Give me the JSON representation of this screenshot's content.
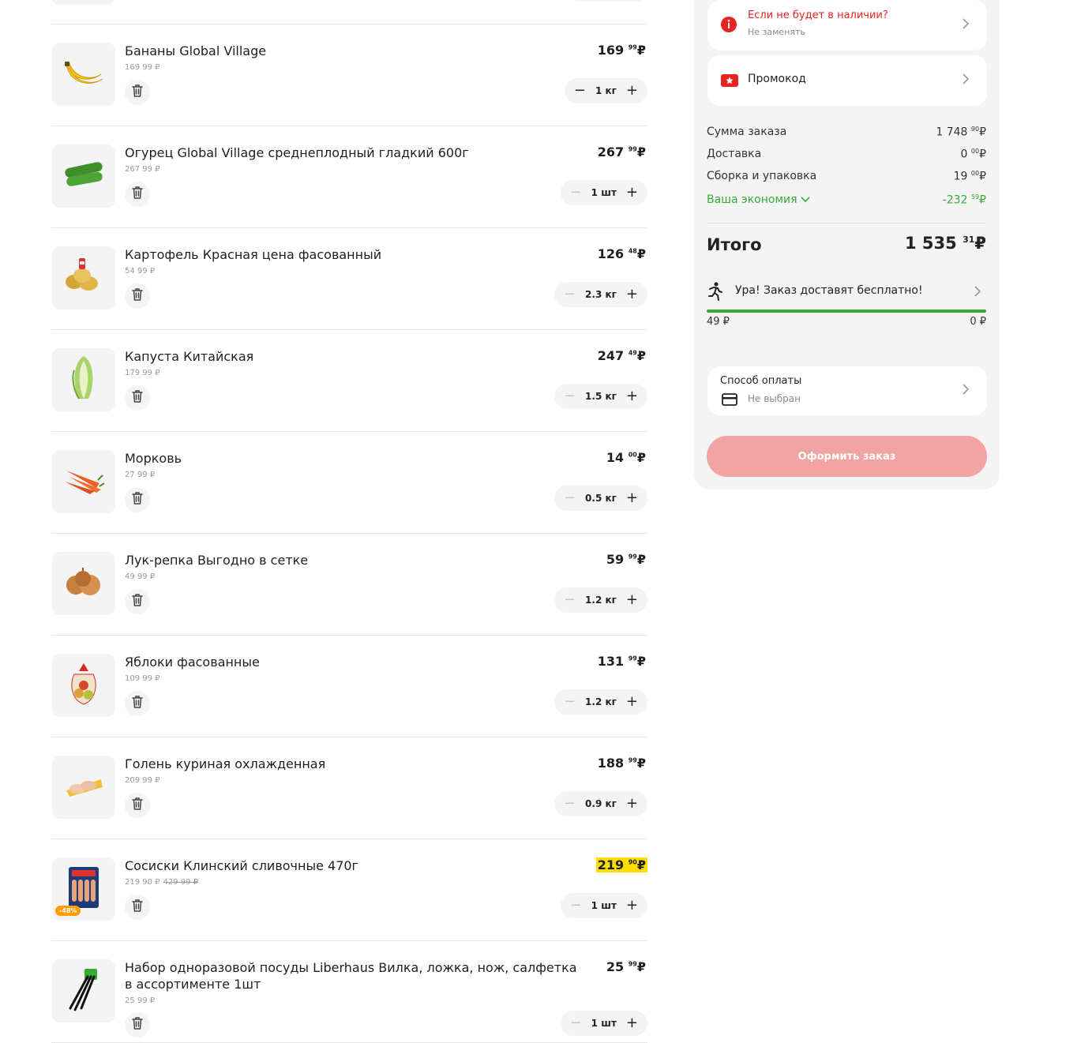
{
  "cart": {
    "items": [
      {
        "title": "Бананы Global Village",
        "unit_price": "169 99 ₽",
        "old_price": "",
        "total_main": "169",
        "total_kop": "99",
        "currency": "₽",
        "qty": "1 кг",
        "promo": false,
        "discount": "",
        "icon": "banana"
      },
      {
        "title": "Огурец Global Village среднеплодный гладкий 600г",
        "unit_price": "267 99 ₽",
        "old_price": "",
        "total_main": "267",
        "total_kop": "99",
        "currency": "₽",
        "qty": "1 шт",
        "promo": false,
        "discount": "",
        "icon": "cucumber"
      },
      {
        "title": "Картофель Красная цена фасованный",
        "unit_price": "54 99 ₽",
        "old_price": "",
        "total_main": "126",
        "total_kop": "48",
        "currency": "₽",
        "qty": "2.3 кг",
        "promo": false,
        "discount": "",
        "icon": "potato"
      },
      {
        "title": "Капуста Китайская",
        "unit_price": "179 99 ₽",
        "old_price": "",
        "total_main": "247",
        "total_kop": "49",
        "currency": "₽",
        "qty": "1.5 кг",
        "promo": false,
        "discount": "",
        "icon": "cabbage"
      },
      {
        "title": "Морковь",
        "unit_price": "27 99 ₽",
        "old_price": "",
        "total_main": "14",
        "total_kop": "00",
        "currency": "₽",
        "qty": "0.5 кг",
        "promo": false,
        "discount": "",
        "icon": "carrot"
      },
      {
        "title": "Лук-репка Выгодно в сетке",
        "unit_price": "49 99 ₽",
        "old_price": "",
        "total_main": "59",
        "total_kop": "99",
        "currency": "₽",
        "qty": "1.2 кг",
        "promo": false,
        "discount": "",
        "icon": "onion"
      },
      {
        "title": "Яблоки фасованные",
        "unit_price": "109 99 ₽",
        "old_price": "",
        "total_main": "131",
        "total_kop": "99",
        "currency": "₽",
        "qty": "1.2 кг",
        "promo": false,
        "discount": "",
        "icon": "apples"
      },
      {
        "title": "Голень куриная охлажденная",
        "unit_price": "209 99 ₽",
        "old_price": "",
        "total_main": "188",
        "total_kop": "99",
        "currency": "₽",
        "qty": "0.9 кг",
        "promo": false,
        "discount": "",
        "icon": "chicken"
      },
      {
        "title": "Сосиски Клинский сливочные 470г",
        "unit_price": "219 90 ₽",
        "old_price": "429 99 ₽",
        "total_main": "219",
        "total_kop": "90",
        "currency": "₽",
        "qty": "1 шт",
        "promo": true,
        "discount": "-48%",
        "icon": "sausage"
      },
      {
        "title": "Набор одноразовой посуды Liberhaus Вилка, ложка, нож, салфетка в ассортименте 1шт",
        "unit_price": "25 99 ₽",
        "old_price": "",
        "total_main": "25",
        "total_kop": "99",
        "currency": "₽",
        "qty": "1 шт",
        "promo": false,
        "discount": "",
        "icon": "cutlery"
      }
    ]
  },
  "sidebar": {
    "out_of_stock": {
      "title": "Если не будет в наличии?",
      "subtitle": "Не заменять"
    },
    "promo": {
      "label": "Промокод"
    },
    "summary": {
      "order_sum_label": "Сумма заказа",
      "order_sum_main": "1 748",
      "order_sum_kop": "90",
      "currency": "₽",
      "delivery_label": "Доставка",
      "delivery_main": "0",
      "delivery_kop": "00",
      "packing_label": "Сборка и упаковка",
      "packing_main": "19",
      "packing_kop": "00",
      "savings_label": "Ваша экономия",
      "savings_main": "-232",
      "savings_kop": "59"
    },
    "total": {
      "label": "Итого",
      "main": "1 535",
      "kop": "31",
      "currency": "₽"
    },
    "free_delivery": {
      "text": "Ура! Заказ доставят бесплатно!",
      "left_label": "49 ₽",
      "right_label": "0 ₽",
      "progress_fraction": 1.0
    },
    "payment": {
      "title": "Способ оплаты",
      "subtitle": "Не выбран"
    },
    "checkout_label": "Оформить заказ",
    "colors": {
      "accent_red": "#e52521",
      "green": "#3aa835",
      "promo_yellow": "#ffdd00",
      "checkout_bg": "#f2a3a3"
    }
  }
}
